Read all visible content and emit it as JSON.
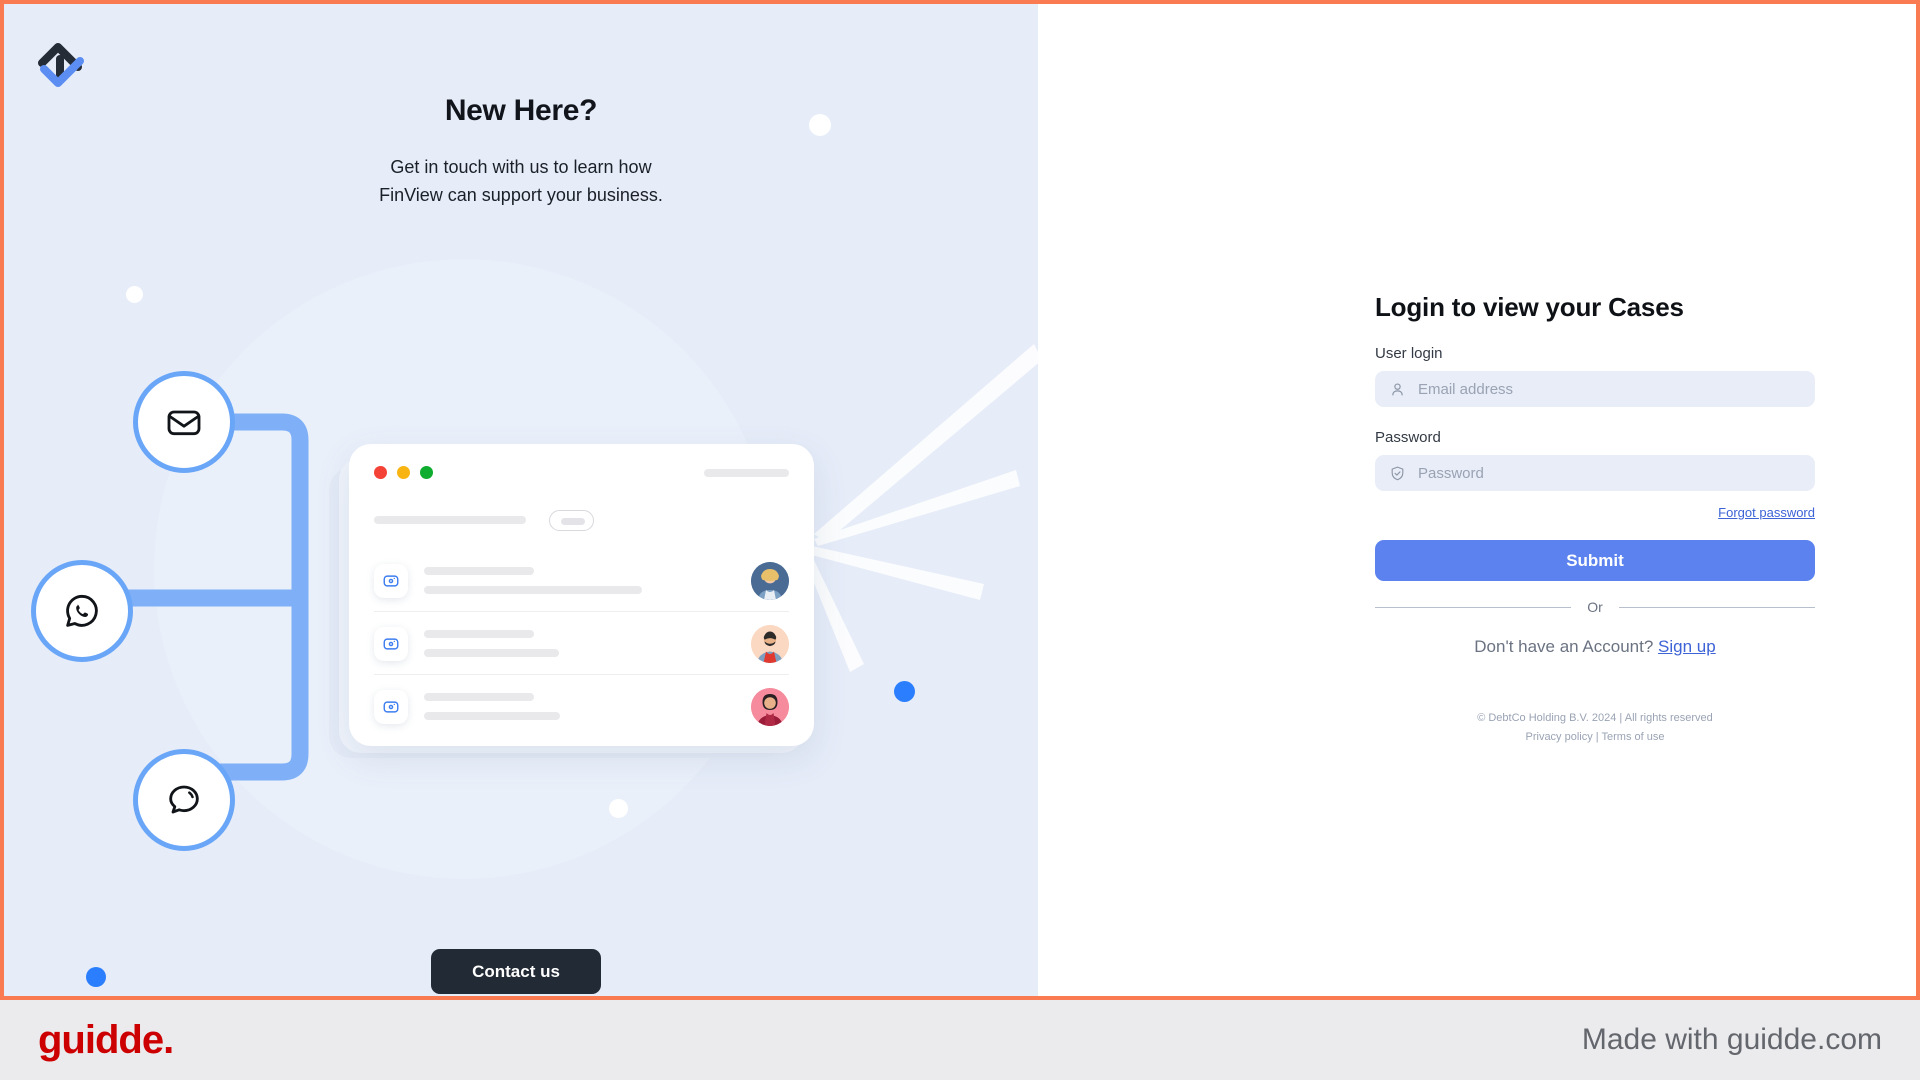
{
  "brand": {
    "logo": "finview-logo-icon",
    "accent": "#5b82ee",
    "frame_color": "#fa7a52"
  },
  "left_panel": {
    "headline": "New Here?",
    "subline_line1": "Get in touch with us to learn how",
    "subline_line2": "FinView can support your business.",
    "contact_button": "Contact us",
    "channels": [
      {
        "name": "email",
        "icon": "envelope-icon"
      },
      {
        "name": "whatsapp",
        "icon": "whatsapp-icon"
      },
      {
        "name": "chat",
        "icon": "chat-bubble-icon"
      }
    ],
    "mock_window": {
      "traffic_lights": [
        "red",
        "yellow",
        "green"
      ],
      "rows": [
        {
          "icon": "case-icon",
          "avatar": "avatar-woman-blonde"
        },
        {
          "icon": "case-icon",
          "avatar": "avatar-man-beard"
        },
        {
          "icon": "case-icon",
          "avatar": "avatar-woman-dark"
        }
      ]
    }
  },
  "login": {
    "title": "Login to view your Cases",
    "user_label": "User login",
    "user_placeholder": "Email address",
    "user_value": "",
    "user_icon": "person-icon",
    "password_label": "Password",
    "password_placeholder": "Password",
    "password_value": "",
    "password_icon": "shield-check-icon",
    "forgot_link": "Forgot password",
    "submit_label": "Submit",
    "divider_label": "Or",
    "signup_prompt": "Don't have an Account?",
    "signup_link": "Sign up",
    "copyright_line1": "© DebtCo Holding B.V. 2024  |  All rights reserved",
    "copyright_line2": "Privacy policy  |  Terms of use"
  },
  "bottom_bar": {
    "logo_text": "guidde.",
    "made_with": "Made with guidde.com"
  }
}
